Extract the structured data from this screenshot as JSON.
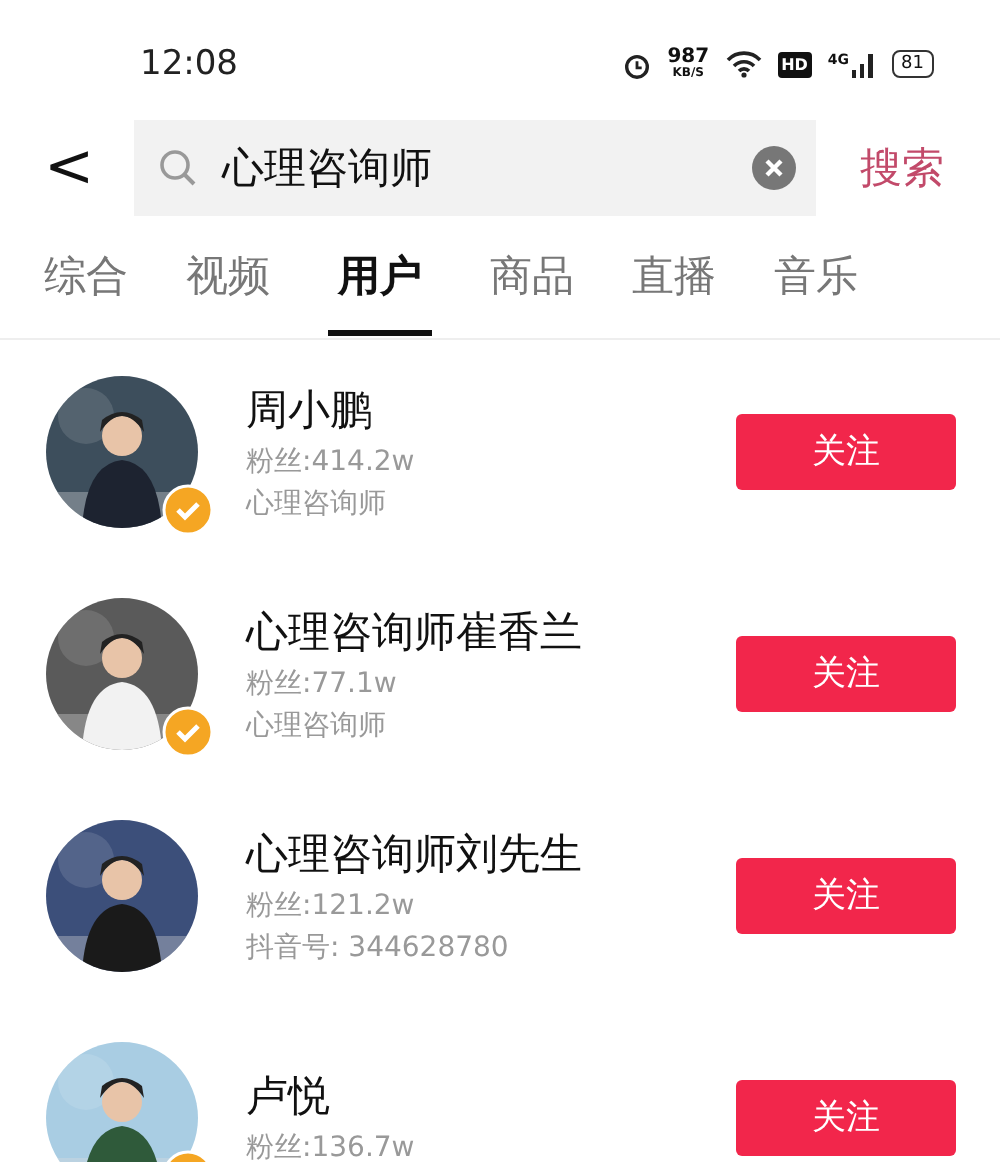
{
  "status_bar": {
    "time": "12:08",
    "speed": "987",
    "speed_unit": "KB/S",
    "hd": "HD",
    "network": "4G",
    "battery": "81"
  },
  "search": {
    "back": "<",
    "value": "心理咨询师",
    "action": "搜索"
  },
  "tabs": [
    {
      "label": "综合",
      "selected": false
    },
    {
      "label": "视频",
      "selected": false
    },
    {
      "label": "用户",
      "selected": true
    },
    {
      "label": "商品",
      "selected": false
    },
    {
      "label": "直播",
      "selected": false
    },
    {
      "label": "音乐",
      "selected": false
    }
  ],
  "users": [
    {
      "name": "周小鹏",
      "fans": "粉丝:414.2w",
      "info": "心理咨询师",
      "verified": true,
      "button": "关注"
    },
    {
      "name": "心理咨询师崔香兰",
      "fans": "粉丝:77.1w",
      "info": "心理咨询师",
      "verified": true,
      "button": "关注"
    },
    {
      "name": "心理咨询师刘先生",
      "fans": "粉丝:121.2w",
      "info": "抖音号: 344628780",
      "verified": false,
      "button": "关注"
    },
    {
      "name": "卢悦",
      "fans": "粉丝:136.7w",
      "verified": true,
      "button": "关注"
    }
  ]
}
